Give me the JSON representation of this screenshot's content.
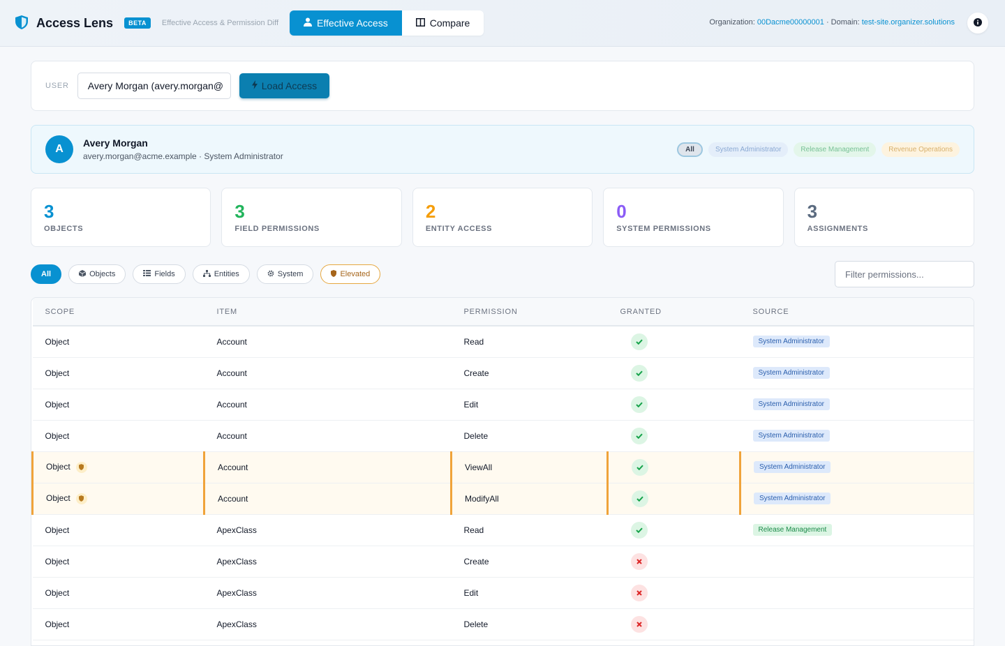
{
  "header": {
    "title": "Access Lens",
    "badge": "BETA",
    "tagline": "Effective Access & Permission Diff",
    "tabs": [
      {
        "label": "Effective Access"
      },
      {
        "label": "Compare"
      }
    ],
    "org_label": "Organization:",
    "org_id": "00Dacme00000001",
    "domain_label": "· Domain:",
    "domain": "test-site.organizer.solutions"
  },
  "user_search": {
    "label": "USER",
    "value": "Avery Morgan (avery.morgan@",
    "button": "Load Access"
  },
  "profile": {
    "initial": "A",
    "name": "Avery Morgan",
    "subtitle": "avery.morgan@acme.example · System Administrator",
    "chips": [
      "All",
      "System Administrator",
      "Release Management",
      "Revenue Operations"
    ]
  },
  "stats": [
    {
      "value": "3",
      "label": "OBJECTS",
      "color": "#0891d1"
    },
    {
      "value": "3",
      "label": "FIELD PERMISSIONS",
      "color": "#22b45c"
    },
    {
      "value": "2",
      "label": "ENTITY ACCESS",
      "color": "#f59e0b"
    },
    {
      "value": "0",
      "label": "SYSTEM PERMISSIONS",
      "color": "#8b5cf6"
    },
    {
      "value": "3",
      "label": "ASSIGNMENTS",
      "color": "#5b6b80"
    }
  ],
  "filters": [
    "All",
    "Objects",
    "Fields",
    "Entities",
    "System",
    "Elevated"
  ],
  "filter_placeholder": "Filter permissions...",
  "table": {
    "headers": [
      "SCOPE",
      "ITEM",
      "PERMISSION",
      "GRANTED",
      "SOURCE"
    ],
    "rows": [
      {
        "scope": "Object",
        "item": "Account",
        "permission": "Read",
        "granted": true,
        "source": "System Administrator",
        "elevated": false
      },
      {
        "scope": "Object",
        "item": "Account",
        "permission": "Create",
        "granted": true,
        "source": "System Administrator",
        "elevated": false
      },
      {
        "scope": "Object",
        "item": "Account",
        "permission": "Edit",
        "granted": true,
        "source": "System Administrator",
        "elevated": false
      },
      {
        "scope": "Object",
        "item": "Account",
        "permission": "Delete",
        "granted": true,
        "source": "System Administrator",
        "elevated": false
      },
      {
        "scope": "Object",
        "item": "Account",
        "permission": "ViewAll",
        "granted": true,
        "source": "System Administrator",
        "elevated": true
      },
      {
        "scope": "Object",
        "item": "Account",
        "permission": "ModifyAll",
        "granted": true,
        "source": "System Administrator",
        "elevated": true
      },
      {
        "scope": "Object",
        "item": "ApexClass",
        "permission": "Read",
        "granted": true,
        "source": "Release Management",
        "elevated": false
      },
      {
        "scope": "Object",
        "item": "ApexClass",
        "permission": "Create",
        "granted": false,
        "source": "",
        "elevated": false
      },
      {
        "scope": "Object",
        "item": "ApexClass",
        "permission": "Edit",
        "granted": false,
        "source": "",
        "elevated": false
      },
      {
        "scope": "Object",
        "item": "ApexClass",
        "permission": "Delete",
        "granted": false,
        "source": "",
        "elevated": false
      }
    ]
  }
}
